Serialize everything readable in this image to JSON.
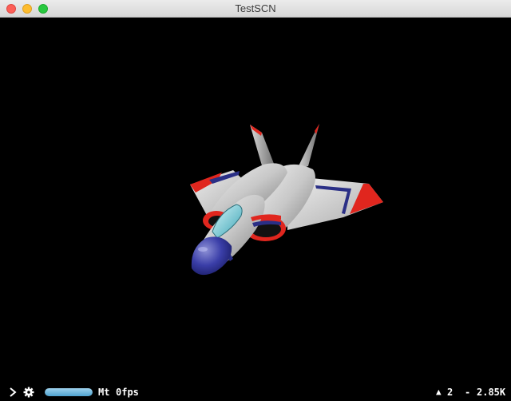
{
  "window": {
    "title": "TestSCN"
  },
  "stats": {
    "expand_icon": "chevron-right-icon",
    "settings_icon": "gear-icon",
    "frame_time_fraction": 1.0,
    "mode_label": "Mt",
    "fps_label": "0fps",
    "draw_call_icon": "▲",
    "draw_calls": "2",
    "separator": "-",
    "count": "2.85K"
  },
  "colors": {
    "background": "#000000",
    "hull": "#c9c9c9",
    "nose": "#2f3197",
    "stripe_red": "#e0261e",
    "stripe_blue": "#2a2f86",
    "canopy": "#7fd6e2"
  }
}
